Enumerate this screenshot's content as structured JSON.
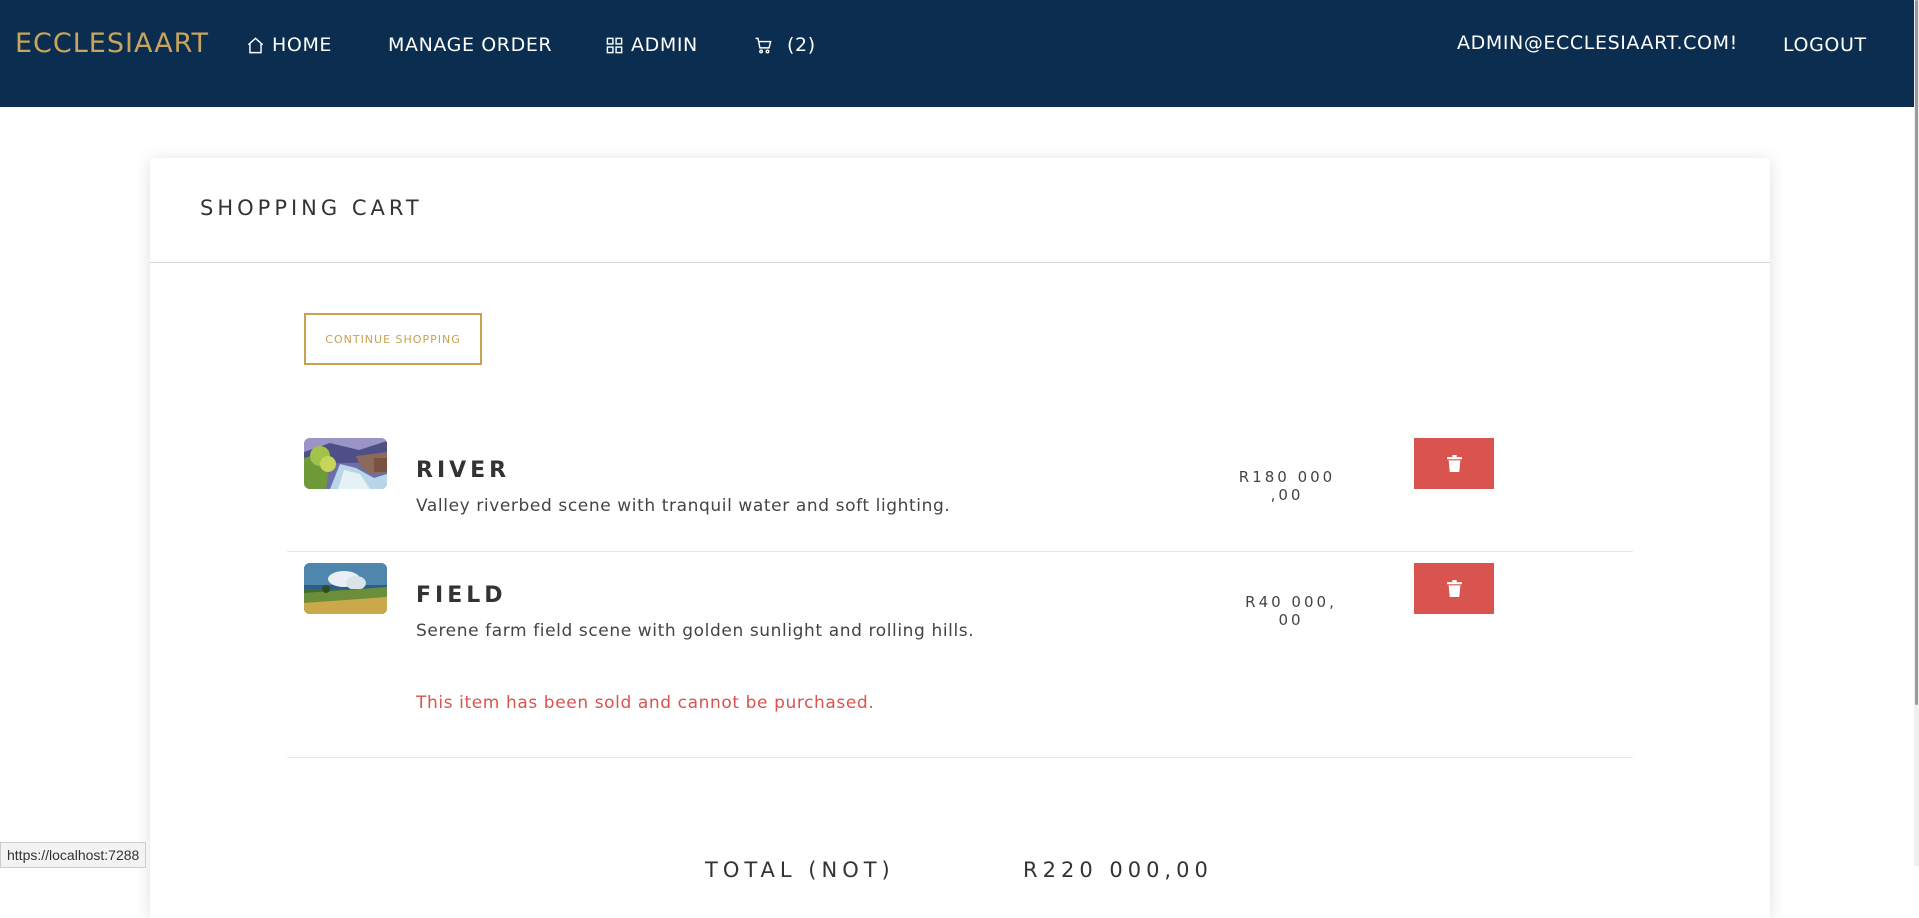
{
  "nav": {
    "brand": "ECCLESIAART",
    "home": "HOME",
    "manage_order": "MANAGE ORDER",
    "admin": "ADMIN",
    "cart_count": "(2)",
    "user_email": "ADMIN@ECCLESIAART.COM!",
    "logout": "LOGOUT"
  },
  "cart": {
    "title": "SHOPPING CART",
    "continue_label": "CONTINUE SHOPPING",
    "items": [
      {
        "title": "RIVER",
        "description": "Valley riverbed scene with tranquil water and soft lighting.",
        "price": "R180 000 ,00",
        "image": "river-painting"
      },
      {
        "title": "FIELD",
        "description": "Serene farm field scene with golden sunlight and rolling hills.",
        "price": "R40 000, 00",
        "image": "field-painting",
        "status": "This item has been sold and cannot be purchased."
      }
    ],
    "total_label": "TOTAL (NOT)",
    "total_value": "R220 000,00"
  },
  "status_url": "https://localhost:7288",
  "colors": {
    "navbar": "#0b2e50",
    "brand": "#caa45d",
    "accent": "#c8a152",
    "danger": "#d9534f"
  }
}
